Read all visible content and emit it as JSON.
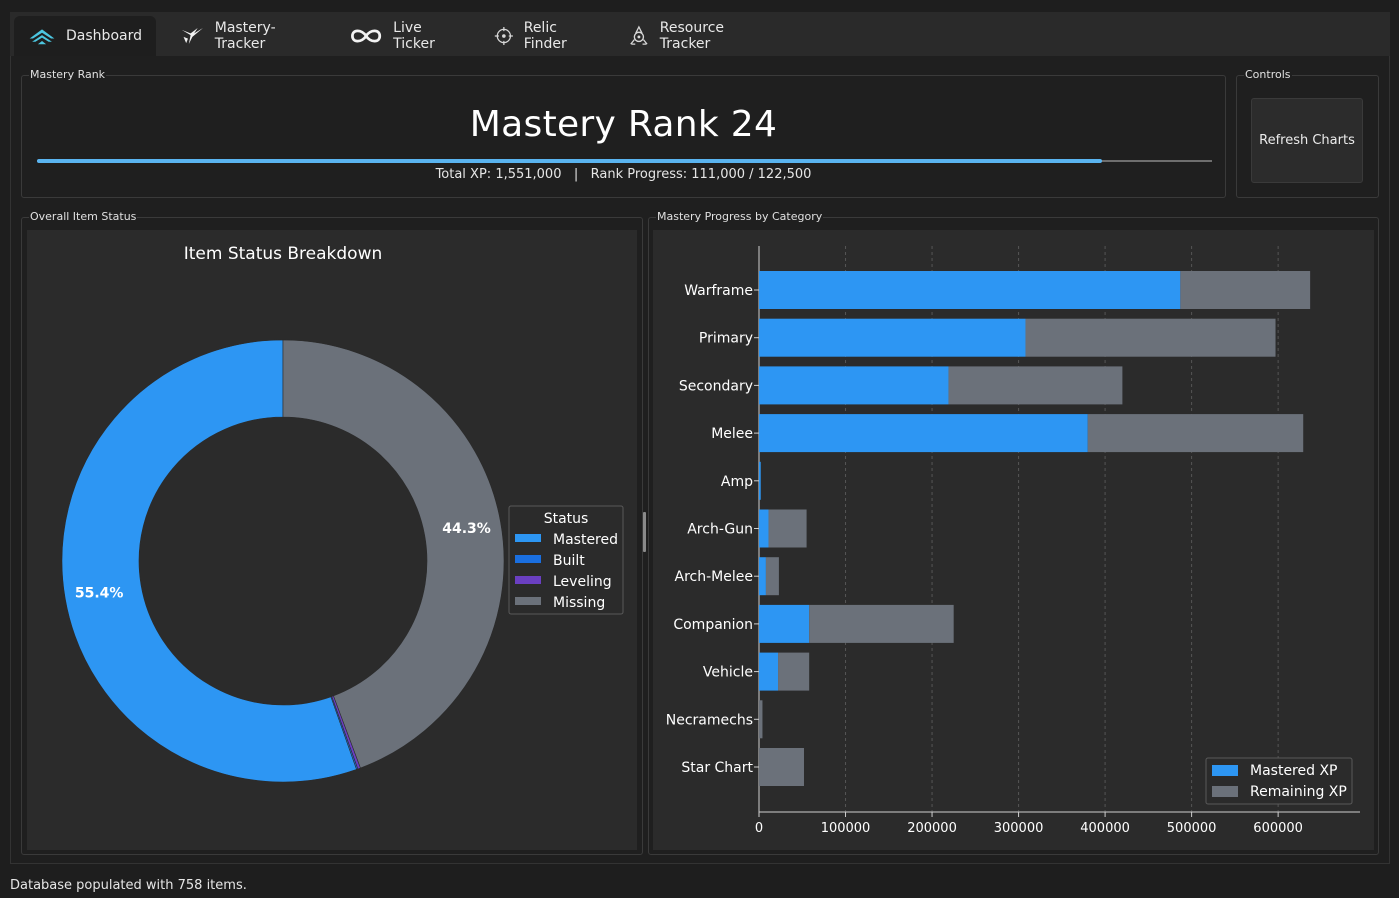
{
  "tabs": [
    {
      "label": "Dashboard",
      "icon": "warframe-logo-icon",
      "active": true
    },
    {
      "label": "Mastery-Tracker",
      "icon": "mastery-sigil-icon",
      "active": false
    },
    {
      "label": "Live Ticker",
      "icon": "infinity-icon",
      "active": false
    },
    {
      "label": "Relic Finder",
      "icon": "crosshair-icon",
      "active": false
    },
    {
      "label": "Resource Tracker",
      "icon": "resource-icon",
      "active": false
    }
  ],
  "mastery_group": {
    "title": "Mastery Rank",
    "rank_label": "Mastery Rank 24",
    "progress_fraction": 0.906,
    "stats": "Total XP: 1,551,000   |   Rank Progress: 111,000 / 122,500"
  },
  "controls_group": {
    "title": "Controls",
    "refresh_label": "Refresh Charts"
  },
  "status_group": {
    "title": "Overall Item Status"
  },
  "category_group": {
    "title": "Mastery Progress by Category"
  },
  "status_bar": "Database populated with 758 items.",
  "colors": {
    "mastered": "#2d96f3",
    "built": "#1a6fe0",
    "leveling": "#6a3fc1",
    "missing": "#6b717a",
    "accent": "#5ab4f0"
  },
  "chart_data": [
    {
      "type": "pie",
      "title": "Item Status Breakdown",
      "legend_title": "Status",
      "legend_position": "right",
      "categories": [
        "Mastered",
        "Built",
        "Leveling",
        "Missing"
      ],
      "values": [
        55.4,
        0.1,
        0.2,
        44.3
      ],
      "labels": [
        "55.4%",
        "",
        "",
        "44.3%"
      ],
      "donut": true
    },
    {
      "type": "bar",
      "orientation": "horizontal",
      "stacked": true,
      "categories": [
        "Warframe",
        "Primary",
        "Secondary",
        "Melee",
        "Amp",
        "Arch-Gun",
        "Arch-Melee",
        "Companion",
        "Vehicle",
        "Necramechs",
        "Star Chart"
      ],
      "series": [
        {
          "name": "Mastered XP",
          "values": [
            487000,
            308000,
            219000,
            380000,
            2000,
            11000,
            8000,
            58000,
            22000,
            0,
            0
          ]
        },
        {
          "name": "Remaining XP",
          "values": [
            150000,
            289000,
            201000,
            249000,
            0,
            44000,
            15000,
            167000,
            36000,
            4000,
            52000
          ]
        }
      ],
      "xlim": [
        0,
        690000
      ],
      "xticks": [
        0,
        100000,
        200000,
        300000,
        400000,
        500000,
        600000
      ],
      "xtick_labels": [
        "0",
        "100000",
        "200000",
        "300000",
        "400000",
        "500000",
        "600000"
      ],
      "grid": "x-dashed",
      "legend_position": "bottom-right"
    }
  ]
}
